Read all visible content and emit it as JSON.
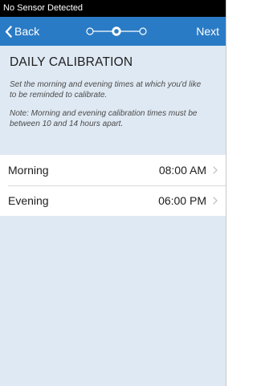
{
  "status_bar": {
    "text": "No Sensor Detected"
  },
  "nav": {
    "back_label": "Back",
    "next_label": "Next",
    "steps_total": 3,
    "current_step": 2
  },
  "page": {
    "title": "DAILY CALIBRATION",
    "description": "Set the morning and evening times at which you'd like to be reminded to calibrate.",
    "note": "Note: Morning and evening calibration times must be between 10 and 14 hours apart."
  },
  "times": [
    {
      "label": "Morning",
      "value": "08:00 AM"
    },
    {
      "label": "Evening",
      "value": "06:00 PM"
    }
  ],
  "colors": {
    "nav_bar": "#2a7bc5",
    "background": "#dfe9f3",
    "status_bar": "#000000"
  },
  "icons": {
    "back": "chevron-left-icon",
    "row_disclosure": "chevron-right-icon"
  }
}
